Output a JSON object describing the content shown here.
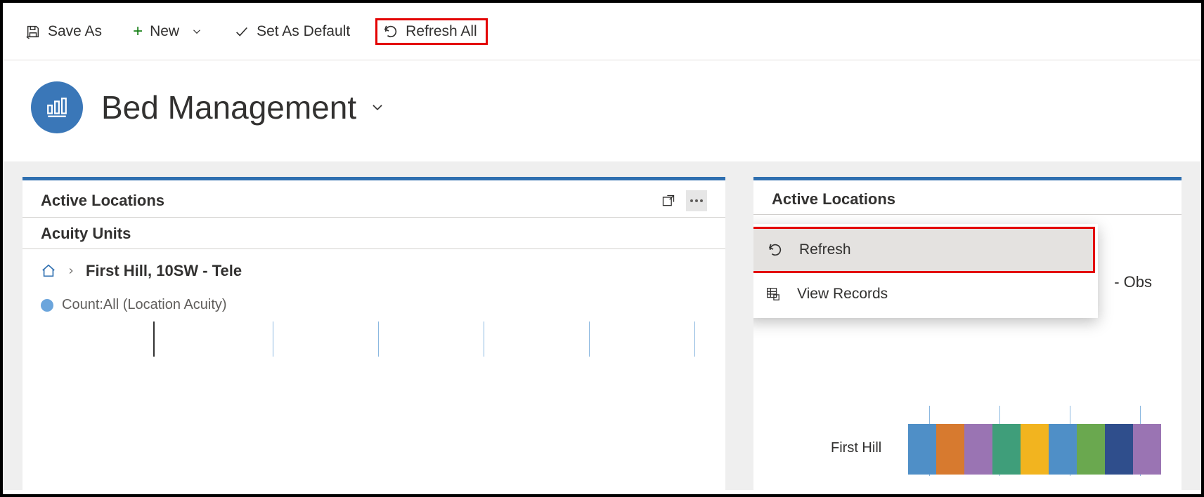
{
  "toolbar": {
    "save_as": "Save As",
    "new": "New",
    "set_default": "Set As Default",
    "refresh_all": "Refresh All"
  },
  "dashboard": {
    "title": "Bed Management"
  },
  "panels": {
    "left": {
      "title": "Active Locations",
      "subtitle": "Acuity Units",
      "breadcrumb": "First Hill, 10SW - Tele",
      "legend": "Count:All (Location Acuity)"
    },
    "right": {
      "title": "Active Locations",
      "breadcrumb_suffix": "- Obs",
      "row_label": "First Hill",
      "bar_colors": [
        "#4f8fc7",
        "#d77a2f",
        "#9a74b3",
        "#3f9e7a",
        "#f2b41f",
        "#4f8fc7",
        "#6aa84f",
        "#2f4e8c",
        "#9a74b3"
      ]
    }
  },
  "context_menu": {
    "refresh": "Refresh",
    "view_records": "View Records"
  }
}
